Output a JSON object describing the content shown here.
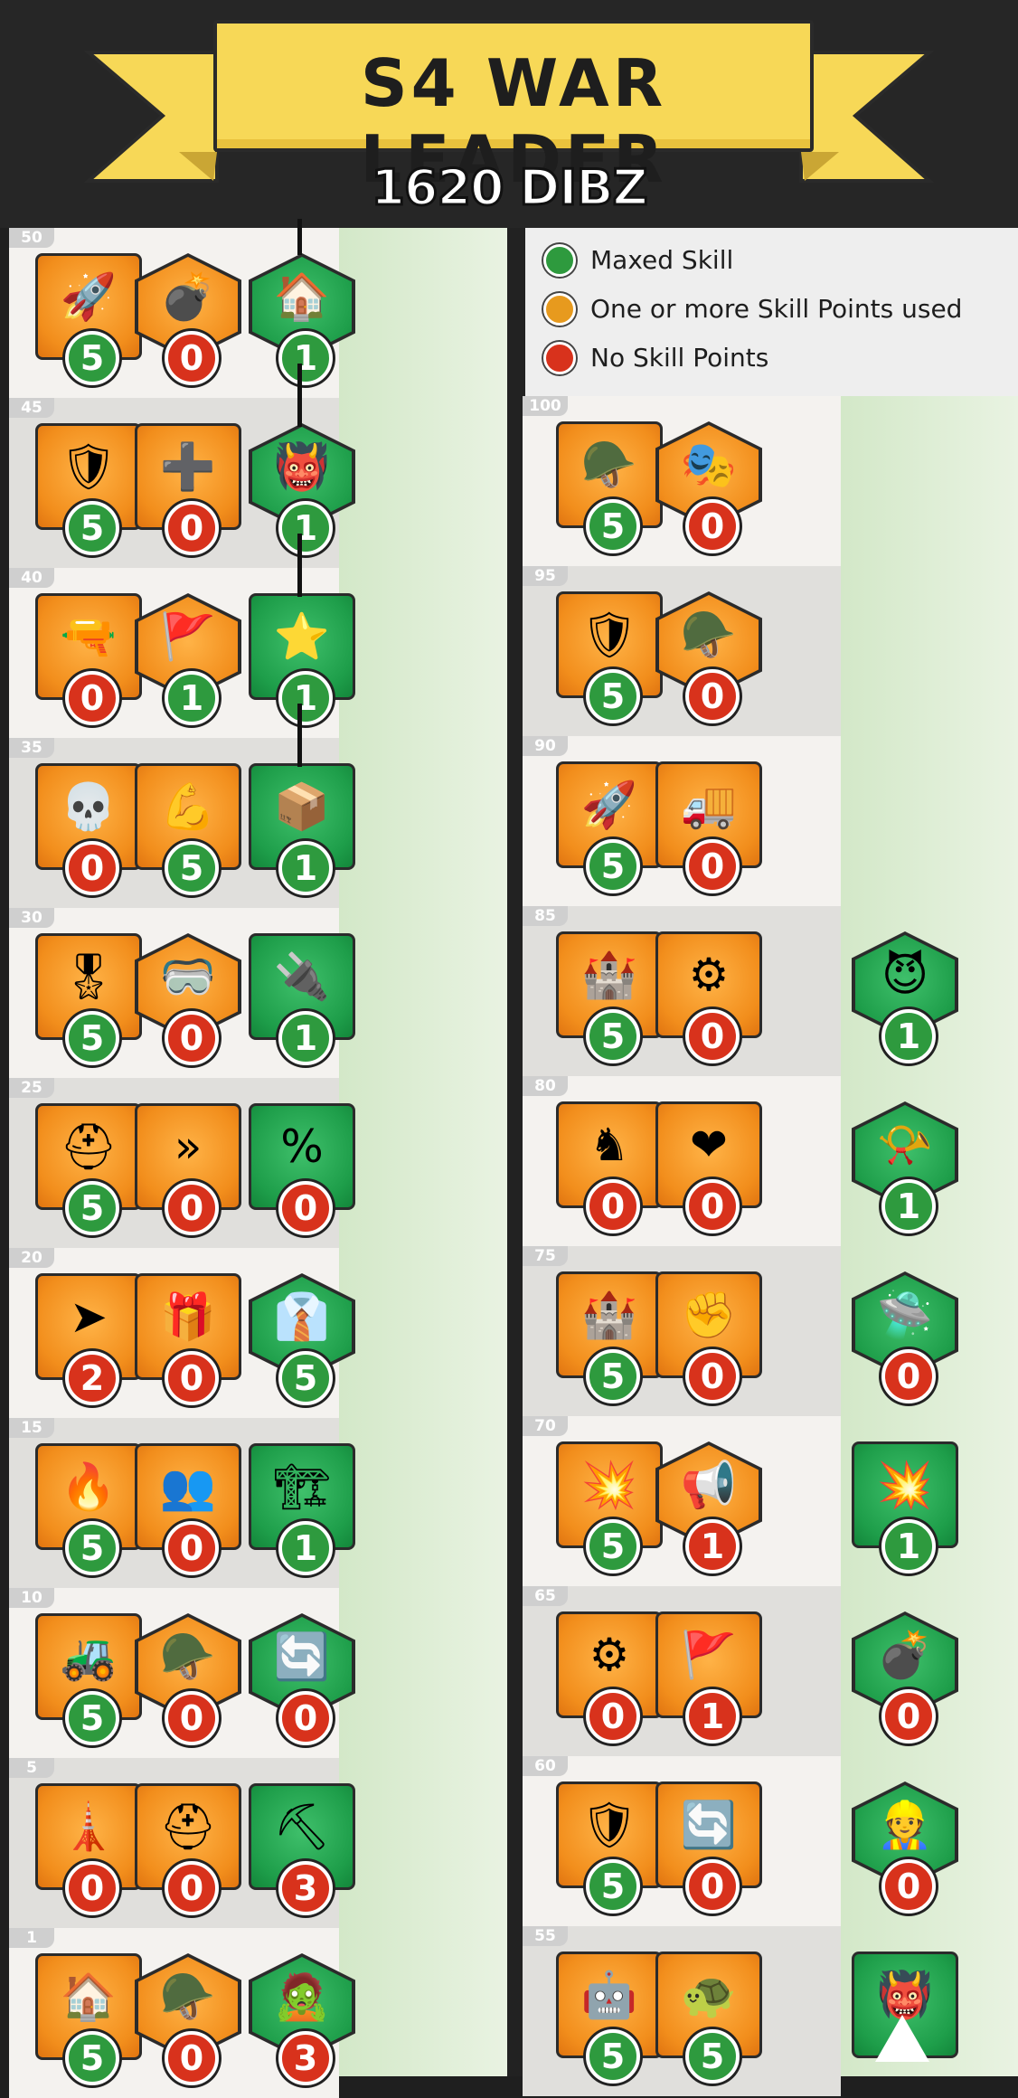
{
  "header": {
    "title": "S4 WAR LEADER",
    "cost": "1620 DIBZ"
  },
  "legend": [
    {
      "label": "Maxed Skill",
      "color": "#2e9a3e"
    },
    {
      "label": "One or more Skill Points used",
      "color": "#e79a1e"
    },
    {
      "label": "No Skill Points",
      "color": "#d8321c"
    }
  ],
  "left_rows": [
    {
      "level": "50",
      "skills": [
        {
          "icon": "rocket-launcher-icon",
          "shape": "sq",
          "value": "5",
          "maxed": true
        },
        {
          "icon": "landmine-icon",
          "shape": "hex",
          "value": "0",
          "maxed": false
        },
        {
          "icon": "hq-explosion-icon",
          "shape": "hex",
          "value": "1",
          "maxed": true
        }
      ]
    },
    {
      "level": "45",
      "skills": [
        {
          "icon": "shield-gear-icon",
          "shape": "sq",
          "value": "5",
          "maxed": true
        },
        {
          "icon": "medic-soldier-icon",
          "shape": "sq",
          "value": "0",
          "maxed": false
        },
        {
          "icon": "viking-helmet-icon",
          "shape": "hex",
          "value": "1",
          "maxed": true
        }
      ]
    },
    {
      "level": "40",
      "skills": [
        {
          "icon": "blaster-icon",
          "shape": "sq",
          "value": "0",
          "maxed": false
        },
        {
          "icon": "red-flag-icon",
          "shape": "hex",
          "value": "1",
          "maxed": true
        },
        {
          "icon": "troop-boost-icon",
          "shape": "sq",
          "value": "1",
          "maxed": true
        }
      ]
    },
    {
      "level": "35",
      "skills": [
        {
          "icon": "skull-shield-icon",
          "shape": "sq",
          "value": "0",
          "maxed": false
        },
        {
          "icon": "muscle-shield-icon",
          "shape": "sq",
          "value": "5",
          "maxed": true
        },
        {
          "icon": "gold-chest-icon",
          "shape": "sq",
          "value": "1",
          "maxed": true
        }
      ]
    },
    {
      "level": "30",
      "skills": [
        {
          "icon": "commander-icon",
          "shape": "sq",
          "value": "5",
          "maxed": true
        },
        {
          "icon": "goggles-trooper-icon",
          "shape": "hex",
          "value": "0",
          "maxed": false
        },
        {
          "icon": "exp-plug-icon",
          "shape": "sq",
          "value": "1",
          "maxed": true
        }
      ]
    },
    {
      "level": "25",
      "skills": [
        {
          "icon": "helmet-icon",
          "shape": "sq",
          "value": "5",
          "maxed": true
        },
        {
          "icon": "speed-chevron-icon",
          "shape": "sq",
          "value": "0",
          "maxed": false
        },
        {
          "icon": "discount-tag-icon",
          "shape": "sq",
          "value": "0",
          "maxed": false
        }
      ]
    },
    {
      "level": "20",
      "skills": [
        {
          "icon": "rifleman-arrow-icon",
          "shape": "sq",
          "value": "2",
          "maxed": false
        },
        {
          "icon": "gift-crate-icon",
          "shape": "sq",
          "value": "0",
          "maxed": false
        },
        {
          "icon": "officer-portrait-icon",
          "shape": "hex",
          "value": "5",
          "maxed": true
        }
      ]
    },
    {
      "level": "15",
      "skills": [
        {
          "icon": "fire-blast-icon",
          "shape": "sq",
          "value": "5",
          "maxed": true
        },
        {
          "icon": "twin-troopers-icon",
          "shape": "sq",
          "value": "0",
          "maxed": false
        },
        {
          "icon": "building-refresh-icon",
          "shape": "sq",
          "value": "1",
          "maxed": true
        }
      ]
    },
    {
      "level": "10",
      "skills": [
        {
          "icon": "red-tank-icon",
          "shape": "sq",
          "value": "5",
          "maxed": true
        },
        {
          "icon": "blue-tank-icon",
          "shape": "hex",
          "value": "0",
          "maxed": false
        },
        {
          "icon": "cycle-x2-icon",
          "shape": "hex",
          "value": "0",
          "maxed": false
        }
      ]
    },
    {
      "level": "5",
      "skills": [
        {
          "icon": "tower-icon",
          "shape": "sq",
          "value": "0",
          "maxed": false
        },
        {
          "icon": "medkit-icon",
          "shape": "sq",
          "value": "0",
          "maxed": false
        },
        {
          "icon": "pickaxe-exp-icon",
          "shape": "sq",
          "value": "3",
          "maxed": false
        }
      ]
    },
    {
      "level": "1",
      "skills": [
        {
          "icon": "house-icon",
          "shape": "sq",
          "value": "5",
          "maxed": true
        },
        {
          "icon": "medic-helmet-icon",
          "shape": "hex",
          "value": "0",
          "maxed": false
        },
        {
          "icon": "zombie-exp-icon",
          "shape": "hex",
          "value": "3",
          "maxed": false
        }
      ]
    }
  ],
  "right_rows": [
    {
      "level": "100",
      "skills": [
        {
          "icon": "trooper-blue-helmet-icon",
          "shape": "sq",
          "value": "5",
          "maxed": true
        },
        {
          "icon": "mask-icon",
          "shape": "hex",
          "value": "0",
          "maxed": false
        }
      ]
    },
    {
      "level": "95",
      "skills": [
        {
          "icon": "shield-check-rank-icon",
          "shape": "sq",
          "value": "5",
          "maxed": true
        },
        {
          "icon": "helmet-rank-icon",
          "shape": "hex",
          "value": "0",
          "maxed": false
        }
      ]
    },
    {
      "level": "90",
      "skills": [
        {
          "icon": "rocket-rank-icon",
          "shape": "sq",
          "value": "5",
          "maxed": true
        },
        {
          "icon": "truck-shield-icon",
          "shape": "sq",
          "value": "0",
          "maxed": false
        }
      ]
    },
    {
      "level": "85",
      "skills": [
        {
          "icon": "turret-boost-icon",
          "shape": "sq",
          "value": "5",
          "maxed": true
        },
        {
          "icon": "gear-rank-icon",
          "shape": "sq",
          "value": "0",
          "maxed": false
        },
        {
          "icon": "devil-icon",
          "shape": "hex",
          "value": "1",
          "maxed": true
        }
      ]
    },
    {
      "level": "80",
      "skills": [
        {
          "icon": "knight-rank-icon",
          "shape": "sq",
          "value": "0",
          "maxed": false
        },
        {
          "icon": "heart-plus-icon",
          "shape": "sq",
          "value": "0",
          "maxed": false
        },
        {
          "icon": "whistle-icon",
          "shape": "hex",
          "value": "1",
          "maxed": true
        }
      ]
    },
    {
      "level": "75",
      "skills": [
        {
          "icon": "turret-arrows-icon",
          "shape": "sq",
          "value": "5",
          "maxed": true
        },
        {
          "icon": "fist-arrow-icon",
          "shape": "sq",
          "value": "0",
          "maxed": false
        },
        {
          "icon": "bunker-dome-icon",
          "shape": "hex",
          "value": "0",
          "maxed": false
        }
      ]
    },
    {
      "level": "70",
      "skills": [
        {
          "icon": "cannon-icon",
          "shape": "sq",
          "value": "5",
          "maxed": true
        },
        {
          "icon": "megaphone-icon",
          "shape": "hex",
          "value": "1",
          "maxed": false
        },
        {
          "icon": "mine-blast-icon",
          "shape": "sq",
          "value": "1",
          "maxed": true
        }
      ]
    },
    {
      "level": "65",
      "skills": [
        {
          "icon": "gatling-icon",
          "shape": "sq",
          "value": "0",
          "maxed": false
        },
        {
          "icon": "flag-up-icon",
          "shape": "sq",
          "value": "1",
          "maxed": false
        },
        {
          "icon": "bomb-idea-icon",
          "shape": "hex",
          "value": "0",
          "maxed": false
        }
      ]
    },
    {
      "level": "60",
      "skills": [
        {
          "icon": "shield-check-icon",
          "shape": "sq",
          "value": "5",
          "maxed": true
        },
        {
          "icon": "trooper-refresh-icon",
          "shape": "sq",
          "value": "0",
          "maxed": false
        },
        {
          "icon": "builder-icon",
          "shape": "hex",
          "value": "0",
          "maxed": false
        }
      ]
    },
    {
      "level": "55",
      "skills": [
        {
          "icon": "robot-boost-icon",
          "shape": "sq",
          "value": "5",
          "maxed": true
        },
        {
          "icon": "turtle-exp-icon",
          "shape": "sq",
          "value": "5",
          "maxed": true
        },
        {
          "icon": "horned-exp-icon",
          "shape": "sq",
          "value": "",
          "maxed": false
        }
      ]
    }
  ]
}
